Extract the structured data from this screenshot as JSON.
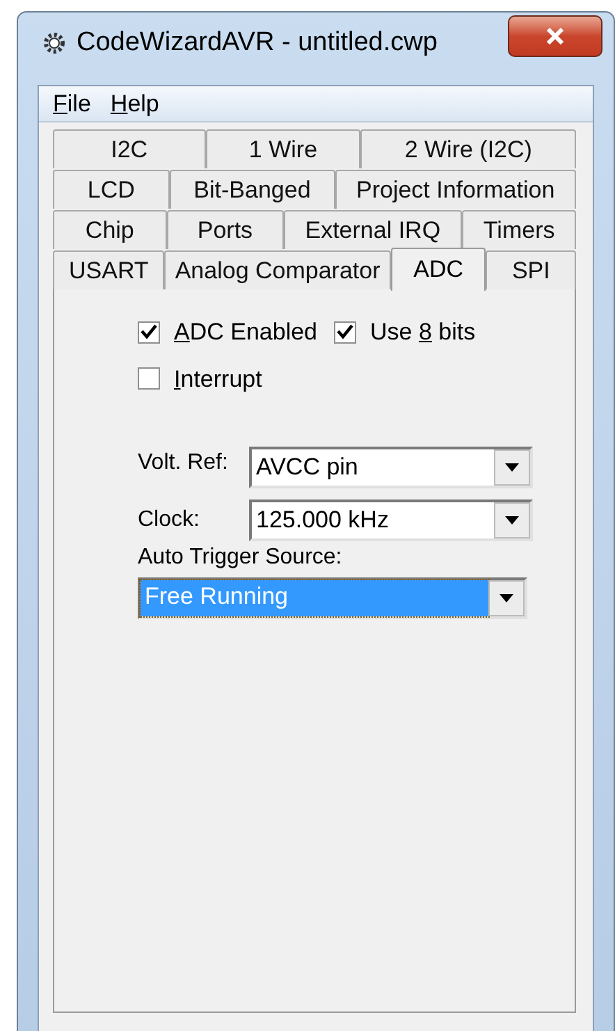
{
  "window": {
    "title": "CodeWizardAVR - untitled.cwp"
  },
  "menu": [
    {
      "key": "F",
      "rest": "ile"
    },
    {
      "key": "H",
      "rest": "elp"
    }
  ],
  "tab_rows": [
    [
      {
        "label": "I2C",
        "selected": false
      },
      {
        "label": "1 Wire",
        "selected": false
      },
      {
        "label": "2 Wire (I2C)",
        "selected": false
      }
    ],
    [
      {
        "label": "LCD",
        "selected": false
      },
      {
        "label": "Bit-Banged",
        "selected": false
      },
      {
        "label": "Project Information",
        "selected": false
      }
    ],
    [
      {
        "label": "Chip",
        "selected": false
      },
      {
        "label": "Ports",
        "selected": false
      },
      {
        "label": "External IRQ",
        "selected": false
      },
      {
        "label": "Timers",
        "selected": false
      }
    ],
    [
      {
        "label": "USART",
        "selected": false
      },
      {
        "label": "Analog Comparator",
        "selected": false
      },
      {
        "label": "ADC",
        "selected": true
      },
      {
        "label": "SPI",
        "selected": false
      }
    ]
  ],
  "checkboxes": [
    {
      "key": "A",
      "after": "DC Enabled",
      "checked": true
    },
    {
      "before": "Use ",
      "key": "8",
      "after": " bits",
      "checked": true
    },
    {
      "key": "I",
      "after": "nterrupt",
      "checked": false
    }
  ],
  "volt_ref": {
    "label": "Volt. Ref:",
    "value": "AVCC pin"
  },
  "clock": {
    "label": "Clock:",
    "value": "125.000 kHz"
  },
  "auto_trigger": {
    "label": "Auto Trigger Source:",
    "value": "Free Running",
    "focused": true
  }
}
